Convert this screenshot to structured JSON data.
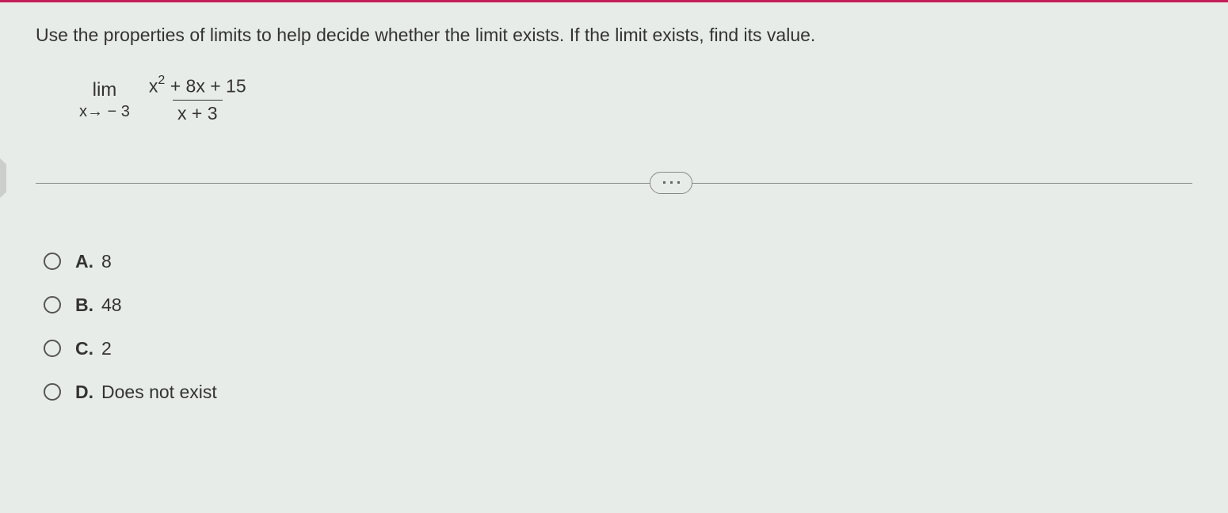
{
  "question": {
    "prompt": "Use the properties of limits to help decide whether the limit exists.  If the limit exists, find its value.",
    "expression": {
      "lim_text": "lim",
      "lim_sub": "x→ − 3",
      "numerator_pre": "x",
      "numerator_exp": "2",
      "numerator_post": " + 8x + 15",
      "denominator": "x + 3"
    }
  },
  "options": [
    {
      "label": "A.",
      "text": "8"
    },
    {
      "label": "B.",
      "text": "48"
    },
    {
      "label": "C.",
      "text": "2"
    },
    {
      "label": "D.",
      "text": "Does not exist"
    }
  ]
}
